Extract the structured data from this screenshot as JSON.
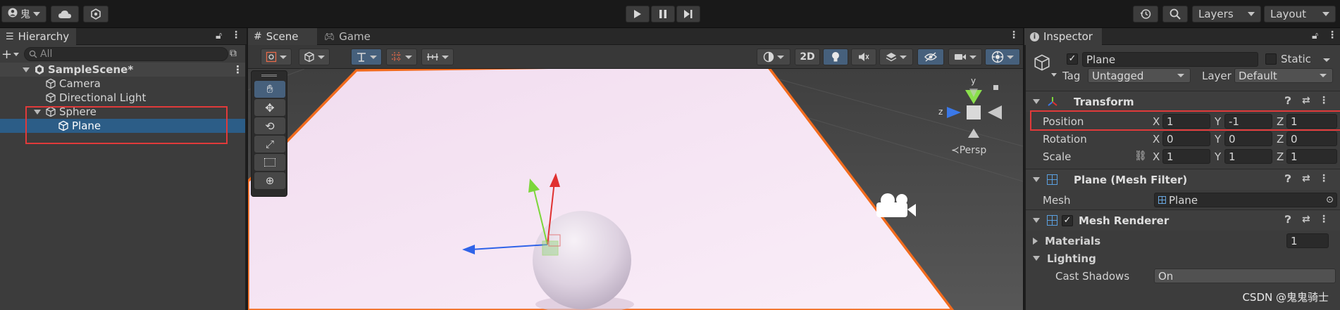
{
  "toolbar": {
    "account_glyph": "鬼",
    "layers_label": "Layers",
    "layout_label": "Layout"
  },
  "hierarchy": {
    "tab_label": "Hierarchy",
    "search_placeholder": "All",
    "items": [
      {
        "label": "SampleScene*"
      },
      {
        "label": "Camera"
      },
      {
        "label": "Directional Light"
      },
      {
        "label": "Sphere"
      },
      {
        "label": "Plane"
      }
    ]
  },
  "scene": {
    "tabs": [
      {
        "label": "Scene"
      },
      {
        "label": "Game"
      }
    ],
    "toggle_2d": "2D",
    "persp_label": "≺Persp",
    "gizmo_axes": {
      "y": "y",
      "z": "z"
    }
  },
  "inspector": {
    "tab_label": "Inspector",
    "object_name": "Plane",
    "static_label": "Static",
    "tag_label": "Tag",
    "tag_value": "Untagged",
    "layer_label": "Layer",
    "layer_value": "Default",
    "transform": {
      "title": "Transform",
      "position_label": "Position",
      "rotation_label": "Rotation",
      "scale_label": "Scale",
      "axis_x": "X",
      "axis_y": "Y",
      "axis_z": "Z",
      "position": {
        "x": "1",
        "y": "-1",
        "z": "1"
      },
      "rotation": {
        "x": "0",
        "y": "0",
        "z": "0"
      },
      "scale": {
        "x": "1",
        "y": "1",
        "z": "1"
      }
    },
    "mesh_filter": {
      "title": "Plane (Mesh Filter)",
      "mesh_label": "Mesh",
      "mesh_value": "Plane"
    },
    "mesh_renderer": {
      "title": "Mesh Renderer",
      "materials_label": "Materials",
      "materials_count": "1",
      "lighting_label": "Lighting",
      "cast_shadows_label": "Cast Shadows",
      "cast_shadows_value": "On"
    }
  },
  "watermark": "CSDN @鬼鬼骑士",
  "colors": {
    "selection": "#2c5d87",
    "outline_orange": "#f26b1d",
    "highlight_red": "#e03a3a",
    "plane_fill": "#f5e4f4"
  }
}
